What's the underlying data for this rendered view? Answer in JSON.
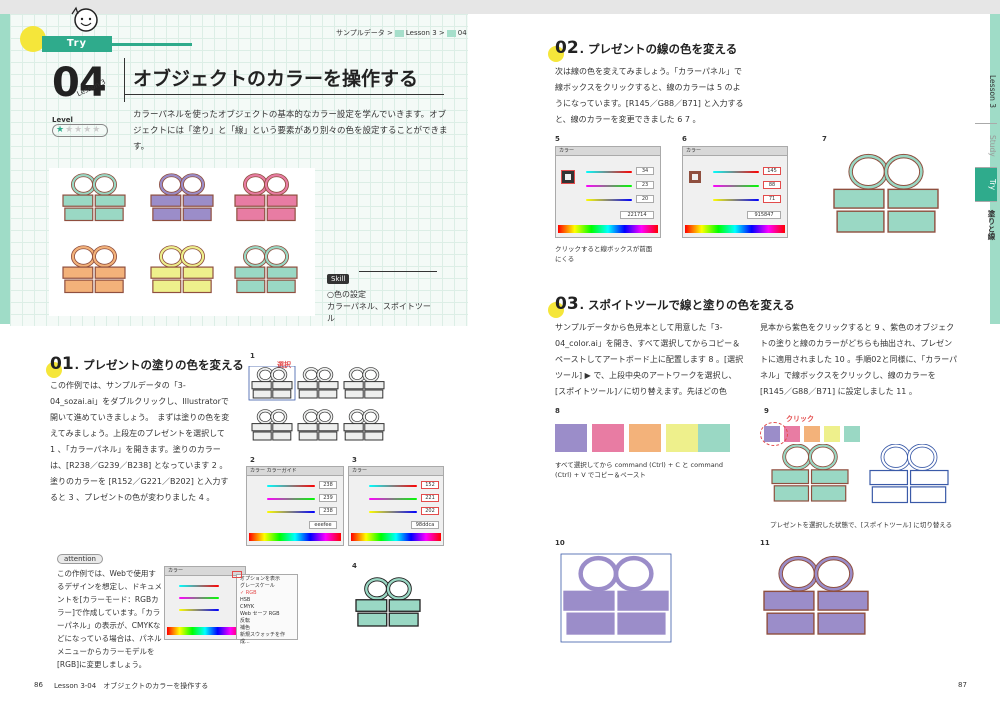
{
  "breadcrumb": {
    "part1": "サンプルデータ >",
    "part2": "Lesson 3 >",
    "part3": "04"
  },
  "header": {
    "try_label": "Try",
    "lesson_number": "04",
    "lesson_label": "Lesson 3",
    "title": "オブジェクトのカラーを操作する",
    "level_label": "Level",
    "level_stars": "★★★★★"
  },
  "intro": "カラーパネルを使ったオブジェクトの基本的なカラー設定を学んでいきます。オブジェクトには「塗り」と「線」という要素があり別々の色を設定することができます。",
  "skill": {
    "tag": "Skill",
    "line1": "○色の設定",
    "line2": "カラーパネル、スポイトツール"
  },
  "section01": {
    "num": "01",
    "title": ". プレゼントの塗りの色を変える",
    "body": "この作例では、サンプルデータの「3-04_sozai.ai」をダブルクリックし、Illustratorで開いて進めていきましょう。　まずは塗りの色を変えてみましょう。上段左のプレゼントを選択して 1 、「カラーパネル」を開きます。塗りのカラーは、[R238／G239／B238] となっています 2 。塗りのカラーを [R152／G221／B202] と入力すると 3 、プレゼントの色が変わりました 4 。"
  },
  "attention": {
    "tag": "attention",
    "body": "この作例では、Webで使用するデザインを想定し、ドキュメントを[カラーモード：RGBカラー]で作成しています。「カラーパネル」の表示が、CMYKなどになっている場合は、パネルメニューからカラーモデルを[RGB]に変更しましょう。"
  },
  "menu": [
    "オプションを表示",
    "グレースケール",
    "✓ RGB",
    "HSB",
    "CMYK",
    "Web セーフ RGB",
    "反転",
    "補色",
    "新規スウォッチを作成..."
  ],
  "section02": {
    "num": "02",
    "title": ". プレゼントの線の色を変える",
    "body": "次は線の色を変えてみましょう。「カラーパネル」で線ボックスをクリックすると、線のカラーは 5 のようになっています。[R145／G88／B71] と入力すると、線のカラーを変更できました 6 7 。"
  },
  "section03": {
    "num": "03",
    "title": ". スポイトツールで線と塗りの色を変える",
    "body_left": "サンプルデータから色見本として用意した「3-04_color.ai」を開き、すべて選択してからコピー＆ペーストしてアートボード上に配置します 8 。[選択ツール] ▶ で、上段中央のアートワークを選択し、[スポイトツール] ⁄ に切り替えます。先ほどの色",
    "body_right": "見本から紫色をクリックすると 9 、紫色のオブジェクトの塗りと線のカラーがどちらも抽出され、プレゼントに適用されました 10 。手順02と同様に、「カラーパネル」で線ボックスをクリックし、線のカラーを [R145／G88／B71] に設定しました 11 。"
  },
  "figures": {
    "f1": "1",
    "f1_note": "選択",
    "f2": "2",
    "f3": "3",
    "f4": "4",
    "f5": "5",
    "f6": "6",
    "f7": "7",
    "f8": "8",
    "f9": "9",
    "f9_note": "クリック",
    "f10": "10",
    "f11": "11"
  },
  "panel_values": {
    "f2": {
      "r": "238",
      "g": "239",
      "b": "238",
      "hex": "eeefee"
    },
    "f3": {
      "r": "152",
      "g": "221",
      "b": "202",
      "hex": "98ddca"
    },
    "f5": {
      "r": "34",
      "g": "23",
      "b": "20",
      "hex": "221714"
    },
    "f6": {
      "r": "145",
      "g": "88",
      "b": "71",
      "hex": "915847"
    }
  },
  "captions": {
    "f5": "クリックすると線ボックスが前面にくる",
    "f8": "すべて選択してから command (Ctrl) + C と command (Ctrl) + V でコピー＆ペースト",
    "f9": "プレゼントを選択した状態で、[スポイトツール] に切り替える"
  },
  "sidebar": {
    "lesson": "Lesson 3",
    "study": "Study",
    "try": "Try",
    "topic": "塗りと線"
  },
  "footer": {
    "left_page": "86",
    "left_text": "Lesson 3-04　オブジェクトのカラーを操作する",
    "right_page": "87"
  },
  "colors": {
    "accent": "#2fab8c",
    "mint": "#9ad8c4",
    "purple": "#9b8dc9",
    "pink": "#e87ca3",
    "orange": "#f3b27a",
    "yellow": "#eef08c",
    "outline": "#8f4f3f",
    "blue_outline": "#3a5aa8"
  }
}
